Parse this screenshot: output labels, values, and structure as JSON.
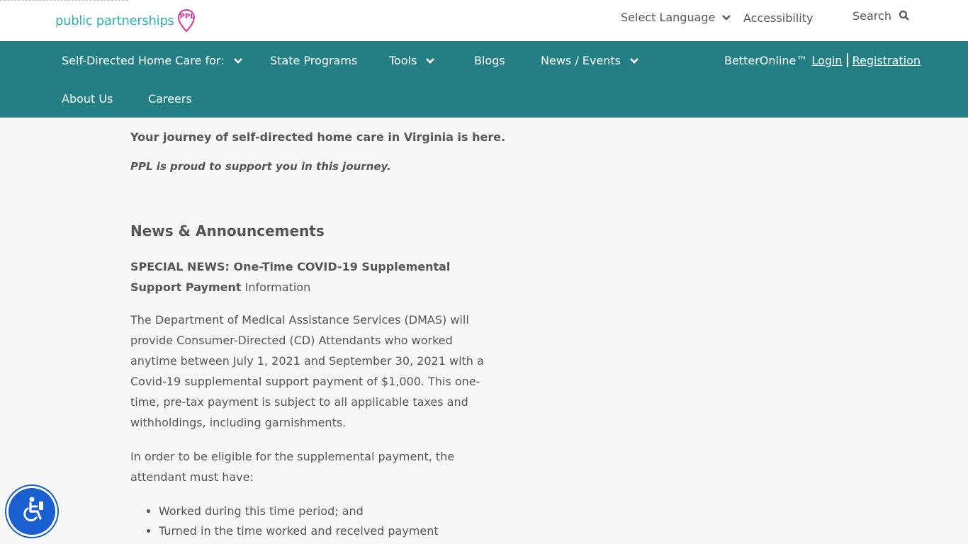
{
  "header": {
    "logo_text": "public partnerships",
    "logo_badge": "PPL",
    "select_language": "Select Language",
    "accessibility": "Accessibility",
    "search": "Search"
  },
  "nav": {
    "items": [
      {
        "label": "Self-Directed Home Care for:",
        "has_dropdown": true
      },
      {
        "label": "State Programs",
        "has_dropdown": false
      },
      {
        "label": "Tools",
        "has_dropdown": true
      },
      {
        "label": "Blogs",
        "has_dropdown": false
      },
      {
        "label": "News / Events",
        "has_dropdown": true
      }
    ],
    "row2": [
      {
        "label": "About Us"
      },
      {
        "label": "Careers"
      }
    ],
    "better_online": "BetterOnline™",
    "login": "Login",
    "registration": "Registration"
  },
  "main": {
    "intro": "Your journey of self-directed home care in Virginia is here.",
    "intro_italic": "PPL is proud to support you in this journey.",
    "section_title": "News & Announcements",
    "special_bold": "SPECIAL NEWS: One-Time COVID-19 Supplemental Support Payment",
    "special_rest": " Information",
    "para1": "The Department of Medical Assistance Services (DMAS) will provide Consumer-Directed (CD) Attendants who worked anytime between July 1, 2021 and September 30, 2021 with a Covid-19 supplemental support payment of $1,000. This one-time, pre-tax payment is subject to all applicable taxes and withholdings, including garnishments.",
    "para2": "In order to be eligible for the supplemental payment, the attendant must have:",
    "bullets": [
      "Worked during this time period; and",
      "Turned in the time worked and received payment"
    ]
  },
  "colors": {
    "nav_bg": "#237f84",
    "logo_teal": "#2bb3b6",
    "logo_pink": "#d6339a",
    "a11y_blue": "#1a5fd0"
  }
}
